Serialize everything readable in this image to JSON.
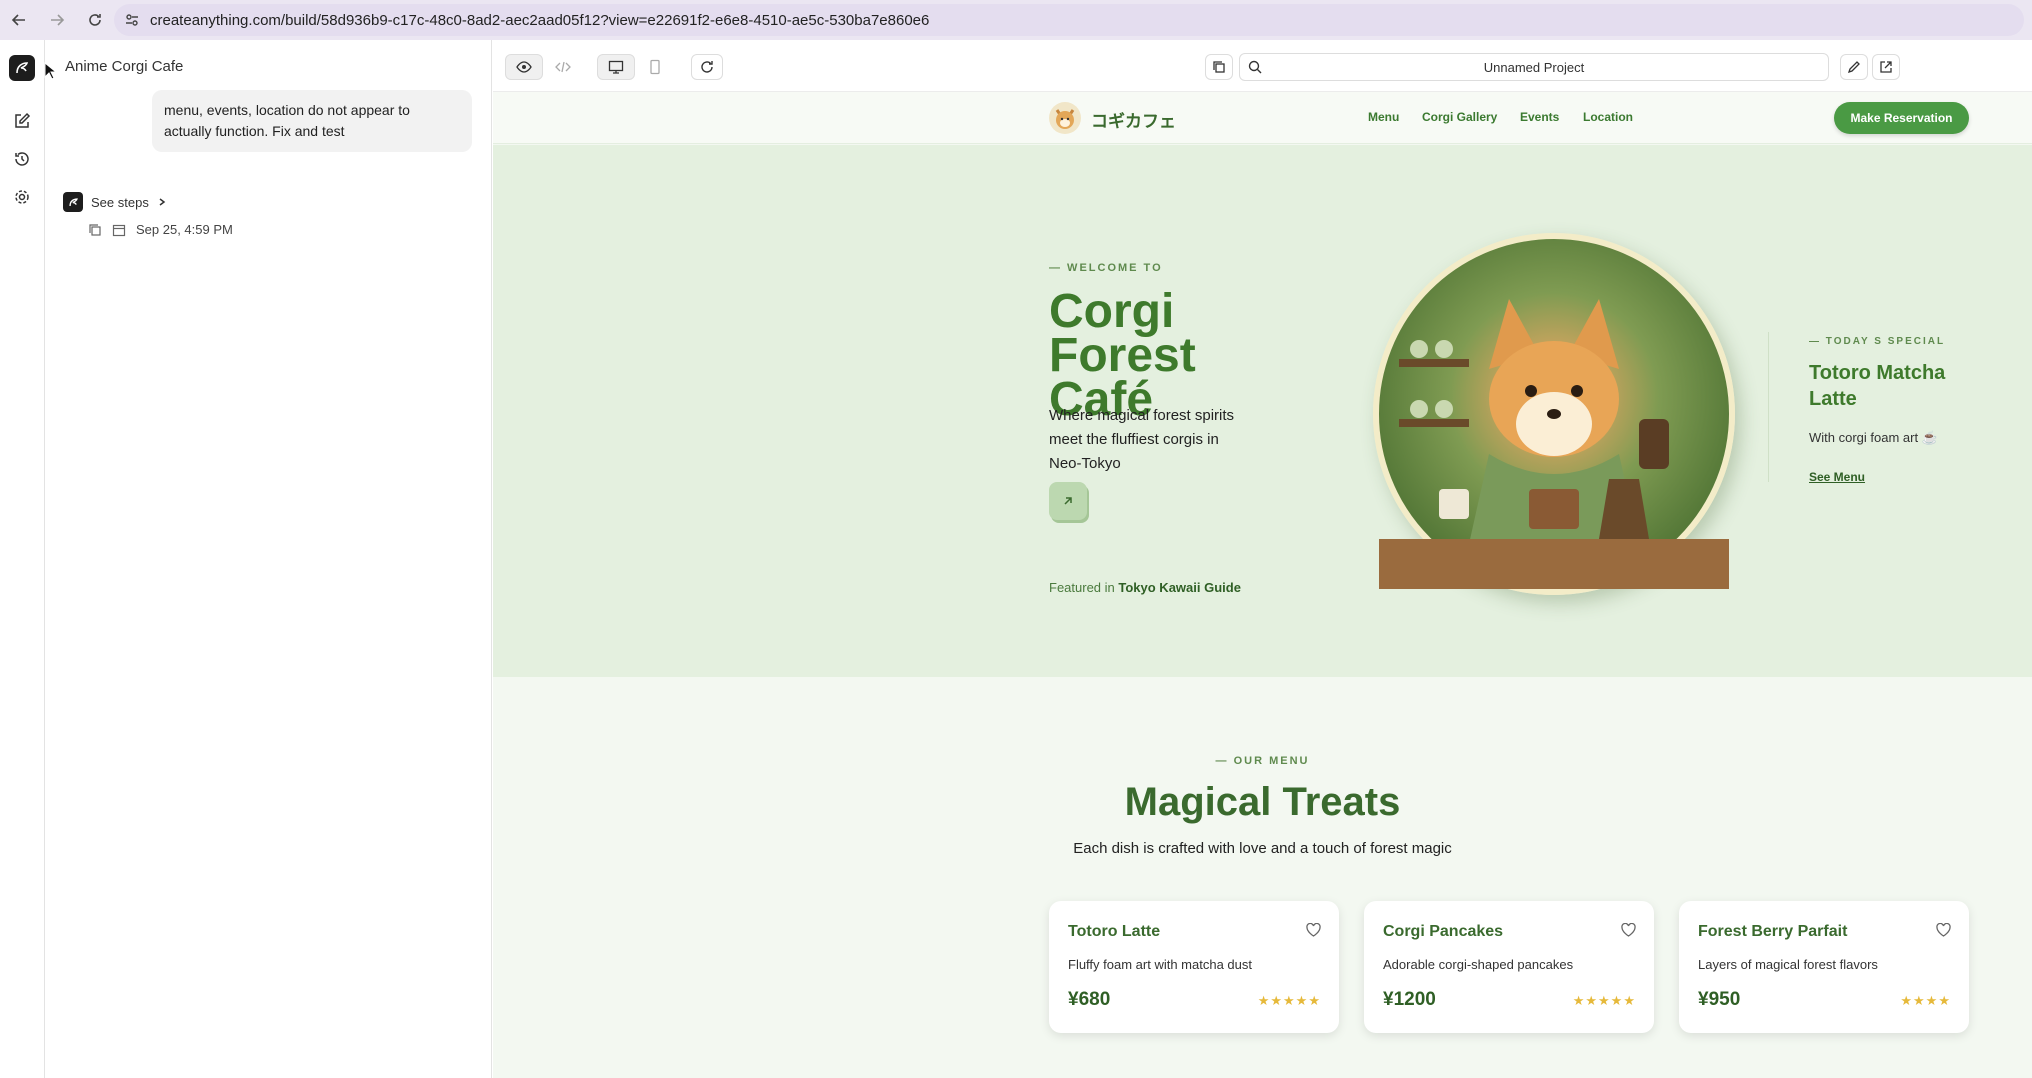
{
  "browser": {
    "url": "createanything.com/build/58d936b9-c17c-48c0-8ad2-aec2aad05f12?view=e22691f2-e6e8-4510-ae5c-530ba7e860e6"
  },
  "chat": {
    "project_title": "Anime Corgi Cafe",
    "message": "menu, events, location do not appear to actually function. Fix and test",
    "see_steps": "See steps",
    "timestamp": "Sep 25, 4:59 PM"
  },
  "preview": {
    "project_name": "Unnamed Project"
  },
  "site": {
    "logo_text": "コギカフェ",
    "nav": [
      "Menu",
      "Corgi Gallery",
      "Events",
      "Location"
    ],
    "reserve_label": "Make Reservation",
    "hero": {
      "tag": "— WELCOME TO",
      "title": "Corgi Forest Café",
      "subtitle": "Where magical forest spirits meet the fluffiest corgis in Neo-Tokyo",
      "featured_prefix": "Featured in ",
      "featured_name": "Tokyo Kawaii Guide"
    },
    "special": {
      "tag": "— TODAY S SPECIAL",
      "title": "Totoro Matcha Latte",
      "desc": "With corgi foam art ☕",
      "link": "See Menu"
    },
    "menu": {
      "tag": "— OUR MENU",
      "title": "Magical Treats",
      "subtitle": "Each dish is crafted with love and a touch of forest magic",
      "items": [
        {
          "name": "Totoro Latte",
          "desc": "Fluffy foam art with matcha dust",
          "price": "¥680",
          "stars": "★★★★★"
        },
        {
          "name": "Corgi Pancakes",
          "desc": "Adorable corgi-shaped pancakes",
          "price": "¥1200",
          "stars": "★★★★★"
        },
        {
          "name": "Forest Berry Parfait",
          "desc": "Layers of magical forest flavors",
          "price": "¥950",
          "stars": "★★★★"
        }
      ]
    }
  },
  "colors": {
    "brand_green": "#3e7a2c",
    "button_green": "#4a9a44",
    "hero_bg": "#e4f0df",
    "star_gold": "#e6b93a"
  },
  "icons": [
    "back-icon",
    "forward-icon",
    "reload-icon",
    "site-settings-icon",
    "app-logo-icon",
    "edit-icon",
    "history-icon",
    "gear-icon",
    "eye-icon",
    "code-icon",
    "desktop-icon",
    "mobile-icon",
    "refresh-icon",
    "copy-icon",
    "search-icon",
    "pencil-icon",
    "external-link-icon",
    "heart-icon",
    "arrow-up-right-icon",
    "calendar-icon",
    "chevron-right-icon"
  ]
}
